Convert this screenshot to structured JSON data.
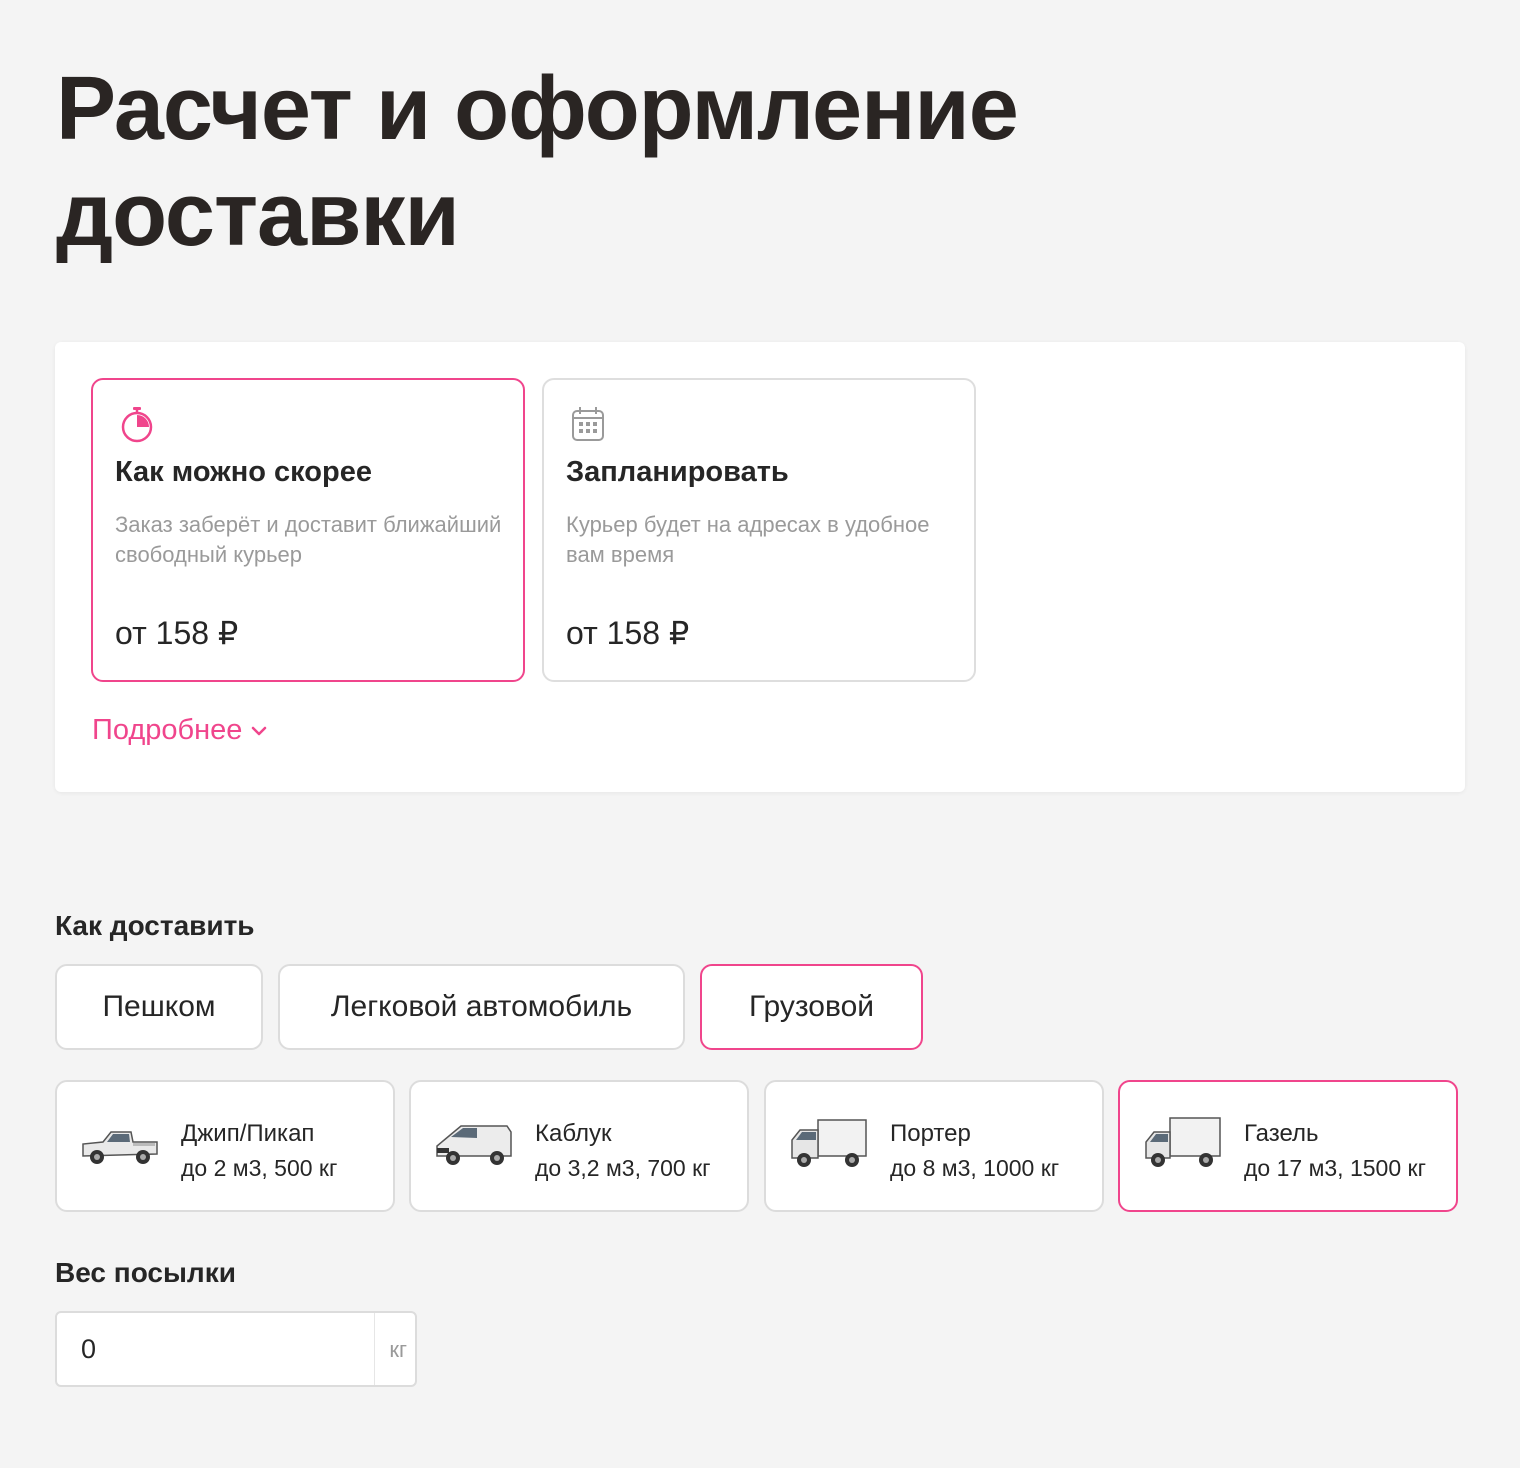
{
  "page": {
    "title": "Расчет и оформление доставки"
  },
  "timing": {
    "options": [
      {
        "title": "Как можно скорее",
        "description": "Заказ заберёт и доставит ближайший свободный курьер",
        "price": "от 158 ₽",
        "icon": "stopwatch-icon",
        "selected": true
      },
      {
        "title": "Запланировать",
        "description": "Курьер будет на адресах в удобное вам время",
        "price": "от 158 ₽",
        "icon": "calendar-icon",
        "selected": false
      }
    ],
    "more_label": "Подробнее"
  },
  "delivery": {
    "label": "Как доставить",
    "modes": [
      "Пешком",
      "Легковой автомобиль",
      "Грузовой"
    ],
    "selected_mode": "Грузовой",
    "vehicles": [
      {
        "name": "Джип/Пикап",
        "spec": "до 2 м3, 500 кг",
        "icon": "pickup-truck-icon",
        "selected": false
      },
      {
        "name": "Каблук",
        "spec": "до 3,2 м3, 700 кг",
        "icon": "van-icon",
        "selected": false
      },
      {
        "name": "Портер",
        "spec": "до 8 м3, 1000 кг",
        "icon": "box-truck-icon",
        "selected": false
      },
      {
        "name": "Газель",
        "spec": "до 17 м3, 1500 кг",
        "icon": "cargo-truck-icon",
        "selected": true
      }
    ]
  },
  "weight": {
    "label": "Вес посылки",
    "value": "0",
    "unit": "кг"
  },
  "colors": {
    "accent": "#f0458c",
    "border": "#dcdcdc",
    "background": "#f4f4f4",
    "muted": "#9a9a9a"
  }
}
